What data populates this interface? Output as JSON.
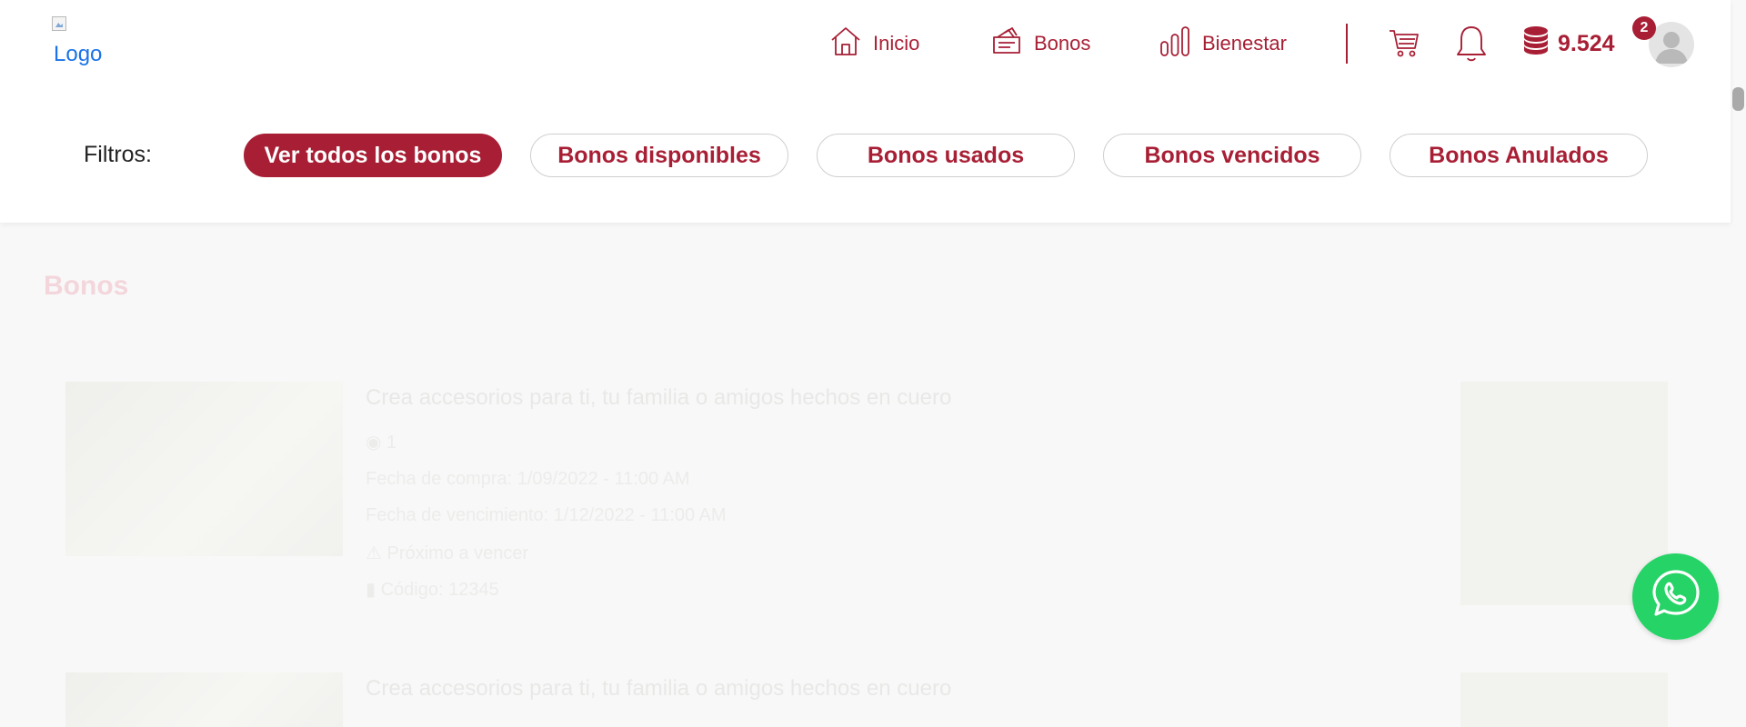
{
  "logo": {
    "alt_text": "Logo"
  },
  "nav": {
    "items": [
      {
        "label": "Inicio",
        "icon": "home-icon"
      },
      {
        "label": "Bonos",
        "icon": "voucher-icon"
      },
      {
        "label": "Bienestar",
        "icon": "bar-chart-icon"
      }
    ],
    "cart_icon": "cart-icon",
    "bell_icon": "bell-icon",
    "points": {
      "value": "9.524",
      "icon": "coins-icon"
    },
    "notification_count": "2",
    "avatar_icon": "user-avatar-icon"
  },
  "filters": {
    "label": "Filtros:",
    "options": [
      {
        "label": "Ver todos los bonos",
        "active": true
      },
      {
        "label": "Bonos disponibles",
        "active": false
      },
      {
        "label": "Bonos usados",
        "active": false
      },
      {
        "label": "Bonos vencidos",
        "active": false
      },
      {
        "label": "Bonos Anulados",
        "active": false
      }
    ]
  },
  "section": {
    "title": "Bonos"
  },
  "cards": [
    {
      "title": "Crea accesorios para ti, tu familia o amigos hechos en cuero",
      "points": "1",
      "purchase_date": "Fecha de compra: 1/09/2022 - 11:00 AM",
      "expiry_date": "Fecha de vencimiento: 1/12/2022 - 11:00 AM",
      "warning": "Próximo a vencer",
      "code": "Código: 12345"
    },
    {
      "title": "Crea accesorios para ti, tu familia o amigos hechos en cuero"
    }
  ],
  "colors": {
    "brand": "#a81f35",
    "whatsapp": "#25d366",
    "header_bg": "#ffffff",
    "page_bg": "#f8f8f8"
  },
  "whatsapp": {
    "icon": "whatsapp-icon"
  }
}
